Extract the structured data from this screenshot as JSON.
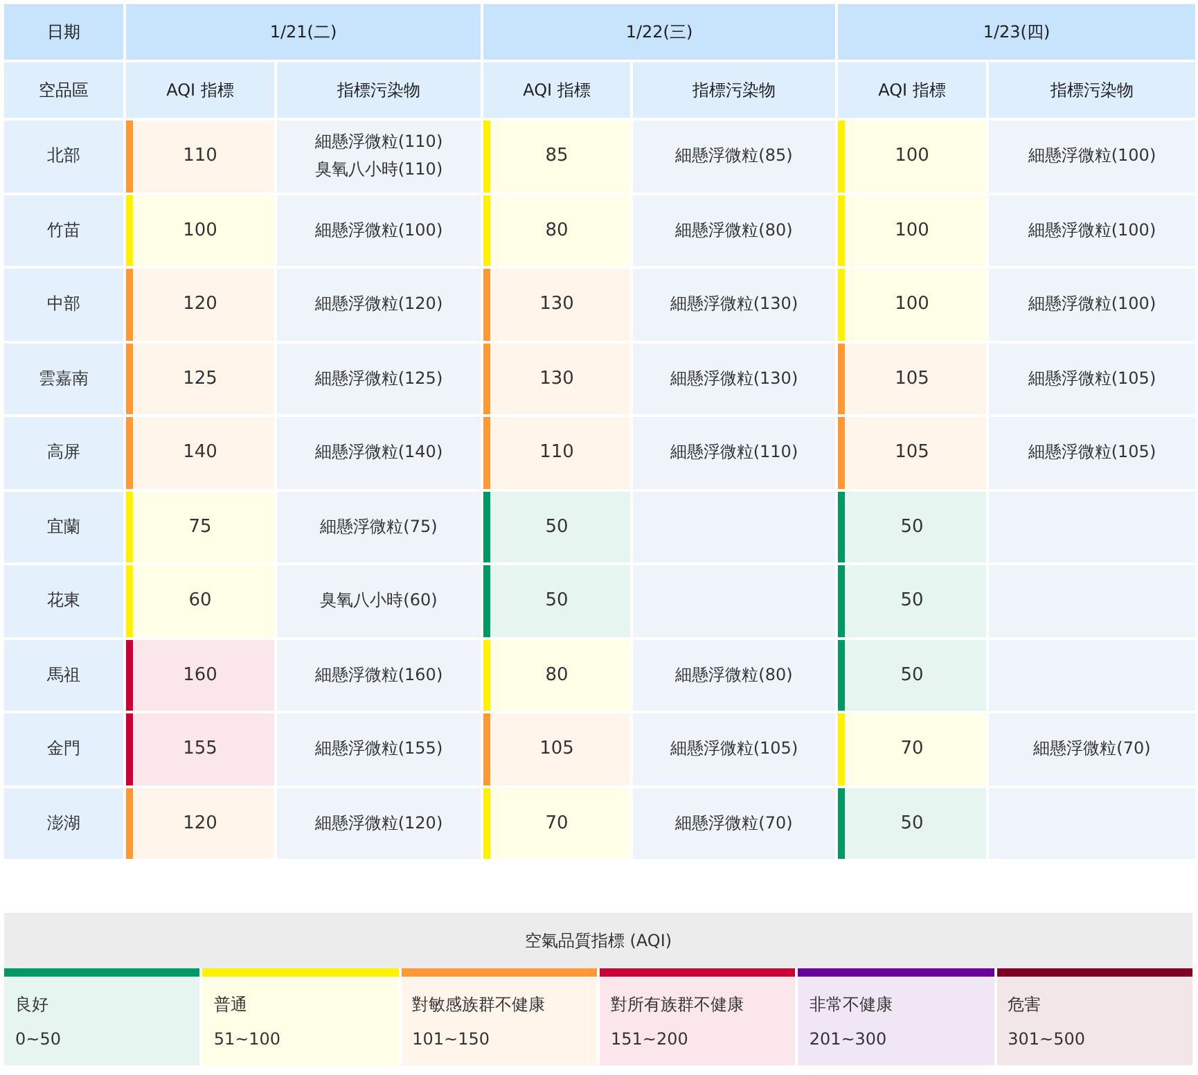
{
  "table": {
    "corner_label": "日期",
    "region_header": "空品區",
    "days": [
      {
        "date": "1/21(二)",
        "aqi_header": "AQI 指標",
        "pollutant_header": "指標污染物"
      },
      {
        "date": "1/22(三)",
        "aqi_header": "AQI 指標",
        "pollutant_header": "指標污染物"
      },
      {
        "date": "1/23(四)",
        "aqi_header": "AQI 指標",
        "pollutant_header": "指標污染物"
      }
    ],
    "rows": [
      {
        "region": "北部",
        "cells": [
          {
            "aqi": "110",
            "color": "#ff9835",
            "pollutants": [
              "細懸浮微粒(110)",
              "臭氧八小時(110)"
            ]
          },
          {
            "aqi": "85",
            "color": "#fff200",
            "pollutants": [
              "細懸浮微粒(85)"
            ]
          },
          {
            "aqi": "100",
            "color": "#fff200",
            "pollutants": [
              "細懸浮微粒(100)"
            ]
          }
        ]
      },
      {
        "region": "竹苗",
        "cells": [
          {
            "aqi": "100",
            "color": "#fff200",
            "pollutants": [
              "細懸浮微粒(100)"
            ]
          },
          {
            "aqi": "80",
            "color": "#fff200",
            "pollutants": [
              "細懸浮微粒(80)"
            ]
          },
          {
            "aqi": "100",
            "color": "#fff200",
            "pollutants": [
              "細懸浮微粒(100)"
            ]
          }
        ]
      },
      {
        "region": "中部",
        "cells": [
          {
            "aqi": "120",
            "color": "#ff9835",
            "pollutants": [
              "細懸浮微粒(120)"
            ]
          },
          {
            "aqi": "130",
            "color": "#ff9835",
            "pollutants": [
              "細懸浮微粒(130)"
            ]
          },
          {
            "aqi": "100",
            "color": "#fff200",
            "pollutants": [
              "細懸浮微粒(100)"
            ]
          }
        ]
      },
      {
        "region": "雲嘉南",
        "cells": [
          {
            "aqi": "125",
            "color": "#ff9835",
            "pollutants": [
              "細懸浮微粒(125)"
            ]
          },
          {
            "aqi": "130",
            "color": "#ff9835",
            "pollutants": [
              "細懸浮微粒(130)"
            ]
          },
          {
            "aqi": "105",
            "color": "#ff9835",
            "pollutants": [
              "細懸浮微粒(105)"
            ]
          }
        ]
      },
      {
        "region": "高屏",
        "cells": [
          {
            "aqi": "140",
            "color": "#ff9835",
            "pollutants": [
              "細懸浮微粒(140)"
            ]
          },
          {
            "aqi": "110",
            "color": "#ff9835",
            "pollutants": [
              "細懸浮微粒(110)"
            ]
          },
          {
            "aqi": "105",
            "color": "#ff9835",
            "pollutants": [
              "細懸浮微粒(105)"
            ]
          }
        ]
      },
      {
        "region": "宜蘭",
        "cells": [
          {
            "aqi": "75",
            "color": "#fff200",
            "pollutants": [
              "細懸浮微粒(75)"
            ]
          },
          {
            "aqi": "50",
            "color": "#009865"
          },
          {
            "aqi": "50",
            "color": "#009865"
          }
        ]
      },
      {
        "region": "花東",
        "cells": [
          {
            "aqi": "60",
            "color": "#fff200",
            "pollutants": [
              "臭氧八小時(60)"
            ]
          },
          {
            "aqi": "50",
            "color": "#009865"
          },
          {
            "aqi": "50",
            "color": "#009865"
          }
        ]
      },
      {
        "region": "馬祖",
        "cells": [
          {
            "aqi": "160",
            "color": "#ca0034",
            "pollutants": [
              "細懸浮微粒(160)"
            ]
          },
          {
            "aqi": "80",
            "color": "#fff200",
            "pollutants": [
              "細懸浮微粒(80)"
            ]
          },
          {
            "aqi": "50",
            "color": "#009865"
          }
        ]
      },
      {
        "region": "金門",
        "cells": [
          {
            "aqi": "155",
            "color": "#ca0034",
            "pollutants": [
              "細懸浮微粒(155)"
            ]
          },
          {
            "aqi": "105",
            "color": "#ff9835",
            "pollutants": [
              "細懸浮微粒(105)"
            ]
          },
          {
            "aqi": "70",
            "color": "#fff200",
            "pollutants": [
              "細懸浮微粒(70)"
            ]
          }
        ]
      },
      {
        "region": "澎湖",
        "cells": [
          {
            "aqi": "120",
            "color": "#ff9835",
            "pollutants": [
              "細懸浮微粒(120)"
            ]
          },
          {
            "aqi": "70",
            "color": "#fff200",
            "pollutants": [
              "細懸浮微粒(70)"
            ]
          },
          {
            "aqi": "50",
            "color": "#009865"
          }
        ]
      }
    ]
  },
  "legend": {
    "title": "空氣品質指標 (AQI)",
    "items": [
      {
        "label": "良好",
        "range": "0~50",
        "color": "#009865"
      },
      {
        "label": "普通",
        "range": "51~100",
        "color": "#fff200"
      },
      {
        "label": "對敏感族群不健康",
        "range": "101~150",
        "color": "#ff9835"
      },
      {
        "label": "對所有族群不健康",
        "range": "151~200",
        "color": "#ca0034"
      },
      {
        "label": "非常不健康",
        "range": "201~300",
        "color": "#670099"
      },
      {
        "label": "危害",
        "range": "301~500",
        "color": "#7e0023"
      }
    ]
  }
}
